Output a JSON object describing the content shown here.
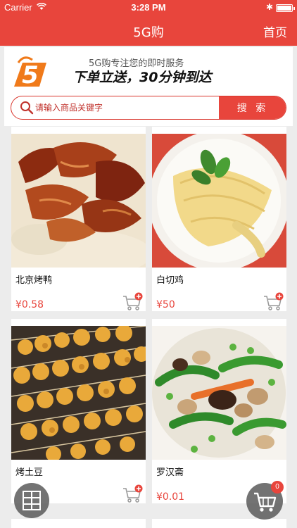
{
  "status_bar": {
    "carrier": "Carrier",
    "time": "3:28 PM"
  },
  "nav": {
    "title": "5G购",
    "home_label": "首页"
  },
  "header": {
    "slogan_line1": "5G购专注您的即时服务",
    "slogan_line2": "下单立送，30分钟到达"
  },
  "search": {
    "placeholder": "请输入商品关键字",
    "button_label": "搜 索"
  },
  "products": [
    {
      "name": "北京烤鸭",
      "price": "¥0.58"
    },
    {
      "name": "白切鸡",
      "price": "¥50"
    },
    {
      "name": "烤土豆",
      "price": ""
    },
    {
      "name": "罗汉斋",
      "price": "¥0.01"
    }
  ],
  "cart": {
    "count": "0"
  },
  "colors": {
    "brand": "#e8453c",
    "logo_orange": "#f07a1a"
  }
}
